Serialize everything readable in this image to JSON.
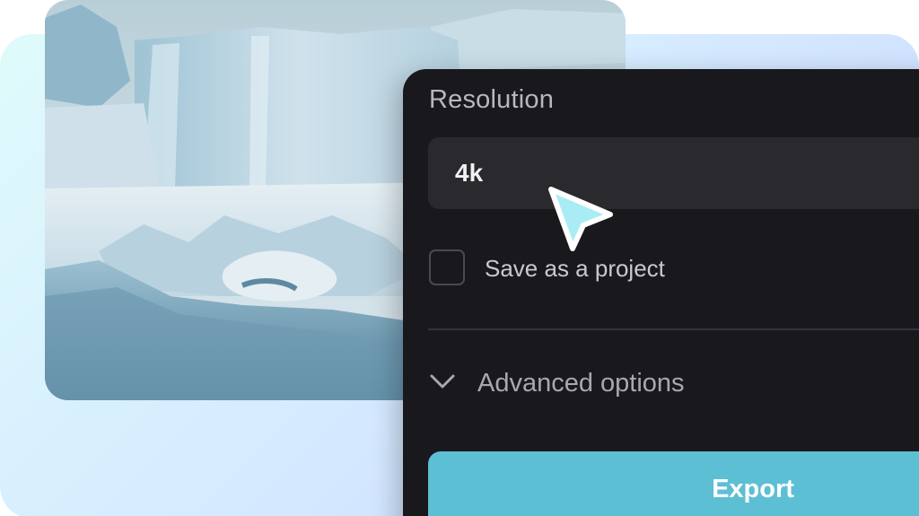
{
  "export_panel": {
    "resolution_label": "Resolution",
    "resolution_value": "4k",
    "save_project_label": "Save as a project",
    "save_project_checked": false,
    "advanced_options_label": "Advanced options",
    "export_button_label": "Export"
  },
  "colors": {
    "panel_background": "#19181d",
    "field_background": "#2a292e",
    "export_button": "#5dbfd3",
    "cursor_fill": "#a9ecf6"
  },
  "icons": {
    "advanced_toggle": "chevron-down-icon",
    "pointer": "cursor-arrow-icon"
  }
}
